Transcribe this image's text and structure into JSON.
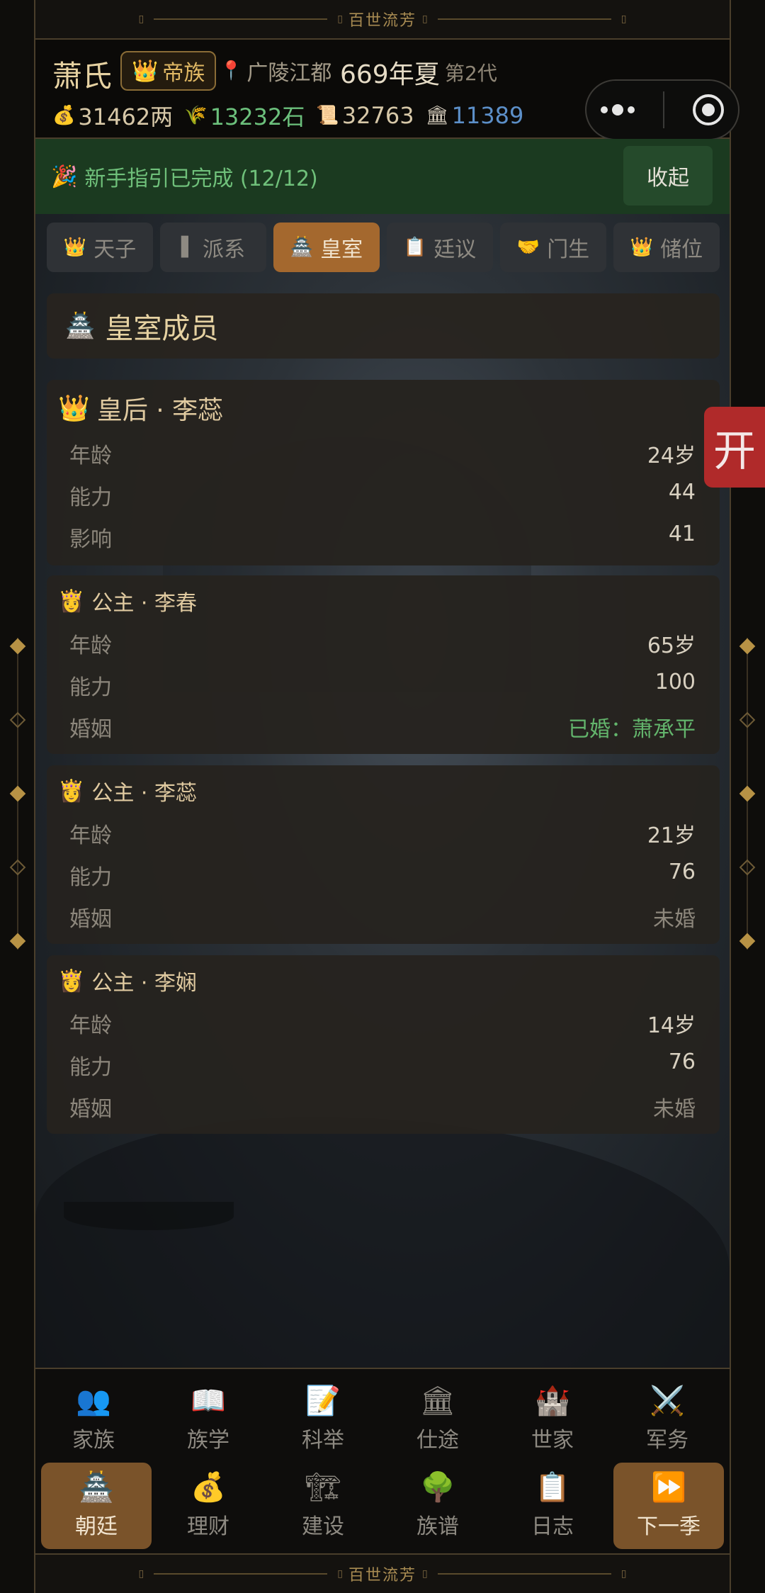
{
  "top_bar": {
    "title": "百世流芳",
    "tick": "▯"
  },
  "bottom_bar": {
    "title": "百世流芳",
    "tick": "▯"
  },
  "header": {
    "clan_name": "萧氏",
    "badge_icon": "👑",
    "badge_label": "帝族",
    "location_icon": "📍",
    "location": "广陵江都",
    "year_season": "669年夏",
    "generation": "第2代",
    "resources": [
      {
        "icon": "💰",
        "value": "31462两",
        "color": "#d7c8a8"
      },
      {
        "icon": "🌾",
        "value": "13232石",
        "color": "#6cc07c"
      },
      {
        "icon": "📜",
        "value": "32763",
        "color": "#d7c8a8"
      },
      {
        "icon": "🏛",
        "value": "11389",
        "color": "#5c8fc8"
      }
    ]
  },
  "guide": {
    "icon": "🎉",
    "text": "新手指引已完成 (12/12)",
    "collapse_label": "收起"
  },
  "tabs": [
    {
      "icon": "👑",
      "label": "天子",
      "active": false
    },
    {
      "icon": "▌",
      "label": "派系",
      "active": false
    },
    {
      "icon": "🏯",
      "label": "皇室",
      "active": true
    },
    {
      "icon": "📋",
      "label": "廷议",
      "active": false
    },
    {
      "icon": "🤝",
      "label": "门生",
      "active": false
    },
    {
      "icon": "👑",
      "label": "储位",
      "active": false
    }
  ],
  "section": {
    "icon": "🏯",
    "title": "皇室成员"
  },
  "members": [
    {
      "icon": "👑",
      "title": "皇后 · 李蕊",
      "rows": [
        {
          "key": "年龄",
          "value": "24岁",
          "style": "normal"
        },
        {
          "key": "能力",
          "value": "44",
          "style": "normal"
        },
        {
          "key": "影响",
          "value": "41",
          "style": "normal"
        }
      ]
    },
    {
      "icon": "👸",
      "title": "公主 · 李春",
      "rows": [
        {
          "key": "年龄",
          "value": "65岁",
          "style": "normal"
        },
        {
          "key": "能力",
          "value": "100",
          "style": "normal"
        },
        {
          "key": "婚姻",
          "value": "已婚：萧承平",
          "style": "green"
        }
      ]
    },
    {
      "icon": "👸",
      "title": "公主 · 李蕊",
      "rows": [
        {
          "key": "年龄",
          "value": "21岁",
          "style": "normal"
        },
        {
          "key": "能力",
          "value": "76",
          "style": "normal"
        },
        {
          "key": "婚姻",
          "value": "未婚",
          "style": "dim"
        }
      ]
    },
    {
      "icon": "👸",
      "title": "公主 · 李娴",
      "rows": [
        {
          "key": "年龄",
          "value": "14岁",
          "style": "normal"
        },
        {
          "key": "能力",
          "value": "76",
          "style": "normal"
        },
        {
          "key": "婚姻",
          "value": "未婚",
          "style": "dim"
        }
      ]
    }
  ],
  "float_button": {
    "label": "开"
  },
  "nav_row1": [
    {
      "icon": "👥",
      "label": "家族"
    },
    {
      "icon": "📖",
      "label": "族学"
    },
    {
      "icon": "📝",
      "label": "科举"
    },
    {
      "icon": "🏛",
      "label": "仕途"
    },
    {
      "icon": "🏰",
      "label": "世家"
    },
    {
      "icon": "⚔️",
      "label": "军务"
    }
  ],
  "nav_row2": [
    {
      "icon": "🏯",
      "label": "朝廷",
      "active": true
    },
    {
      "icon": "💰",
      "label": "理财",
      "active": false
    },
    {
      "icon": "🏗",
      "label": "建设",
      "active": false
    },
    {
      "icon": "🌳",
      "label": "族谱",
      "active": false
    },
    {
      "icon": "📋",
      "label": "日志",
      "active": false
    },
    {
      "icon": "⏩",
      "label": "下一季",
      "active": false
    }
  ]
}
